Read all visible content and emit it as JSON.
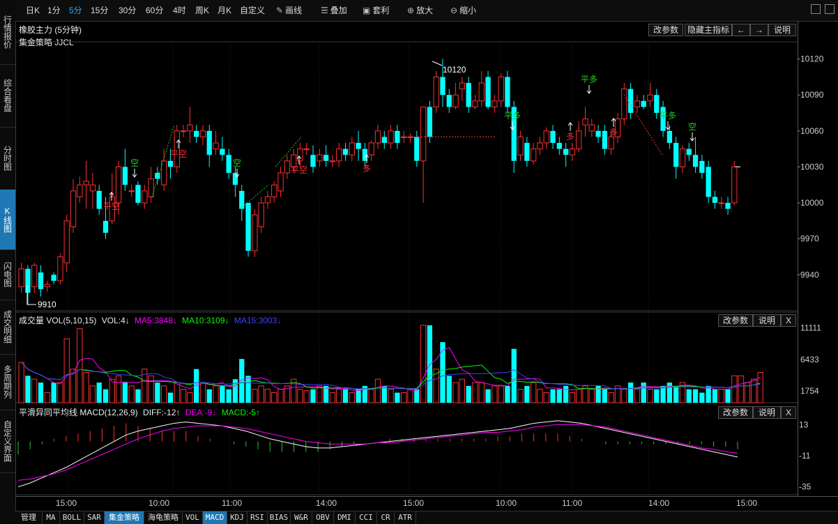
{
  "left_tabs": [
    {
      "label": "行情报价",
      "active": false
    },
    {
      "label": "综合看盘",
      "active": false
    },
    {
      "label": "分时图",
      "active": false
    },
    {
      "label": "K线图",
      "active": true
    },
    {
      "label": "闪电图",
      "active": false
    },
    {
      "label": "成交明细",
      "active": false
    },
    {
      "label": "多周期列",
      "active": false
    },
    {
      "label": "自定义界面",
      "active": false
    }
  ],
  "toolbar": {
    "periods": [
      "日K",
      "1分",
      "5分",
      "15分",
      "30分",
      "60分",
      "4时",
      "周K",
      "月K",
      "自定义"
    ],
    "active_period": "5分",
    "tools": [
      {
        "label": "画线",
        "icon": "pencil-icon"
      },
      {
        "label": "叠加",
        "icon": "stack-icon"
      },
      {
        "label": "套利",
        "icon": "arbitrage-icon"
      },
      {
        "label": "放大",
        "icon": "zoom-in-icon"
      },
      {
        "label": "缩小",
        "icon": "zoom-out-icon"
      }
    ]
  },
  "main_panel": {
    "title": "橡胶主力 (5分钟)",
    "strategy": "集金策略 JJCL",
    "buttons": [
      "改参数",
      "隐藏主指标",
      "←",
      "→",
      "说明"
    ],
    "y_labels": [
      "10120",
      "10090",
      "10060",
      "10030",
      "10000",
      "9970",
      "9940"
    ],
    "high_label": "10120",
    "low_label": "9910"
  },
  "vol_panel": {
    "title": "成交量 VOL(5,10,15)",
    "vol": "VOL:4↓",
    "ma5": "MA5:3848↓",
    "ma10": "MA10:3109↓",
    "ma15": "MA15:3003↓",
    "buttons": [
      "改参数",
      "说明",
      "X"
    ],
    "y_labels": [
      "11111",
      "6433",
      "1754"
    ]
  },
  "macd_panel": {
    "title": "平滑异同平均线 MACD(12,26,9)",
    "diff": "DIFF:-12↑",
    "dea": "DEA:-9↓",
    "macd": "MACD:-5↑",
    "buttons": [
      "改参数",
      "说明",
      "X"
    ],
    "y_labels": [
      "13",
      "-11",
      "-35"
    ]
  },
  "time_axis": [
    "15:00",
    "10:00",
    "11:00",
    "14:00",
    "15:00",
    "10:00",
    "11:00",
    "14:00",
    "15:00"
  ],
  "bottom_tabs": [
    "管理",
    "MA",
    "BOLL",
    "SAR",
    "集金策略",
    "海龟策略",
    "VOL",
    "MACD",
    "KDJ",
    "RSI",
    "BIAS",
    "W&R",
    "OBV",
    "DMI",
    "CCI",
    "CR",
    "ATR"
  ],
  "bottom_active": [
    "集金策略",
    "MACD"
  ],
  "colors": {
    "up": "#ff3030",
    "down": "#00ffff",
    "ma5": "#ff00ff",
    "ma10": "#00ff00",
    "ma15": "#4040ff",
    "diff": "#ffffff",
    "dea": "#ff00ff",
    "signal_green": "#22cc22",
    "signal_red": "#ff3030"
  },
  "signals": [
    {
      "text": "平空",
      "color": "red",
      "dir": "up"
    },
    {
      "text": "空",
      "color": "green",
      "dir": "down"
    },
    {
      "text": "平空",
      "color": "red",
      "dir": "up"
    },
    {
      "text": "空",
      "color": "green",
      "dir": "down"
    },
    {
      "text": "平空",
      "color": "red",
      "dir": "up"
    },
    {
      "text": "多",
      "color": "red",
      "dir": "up"
    },
    {
      "text": "平多",
      "color": "green",
      "dir": "down"
    },
    {
      "text": "多",
      "color": "red",
      "dir": "up"
    },
    {
      "text": "平多",
      "color": "green",
      "dir": "down"
    },
    {
      "text": "多",
      "color": "red",
      "dir": "up"
    },
    {
      "text": "平多",
      "color": "green",
      "dir": "down"
    },
    {
      "text": "空",
      "color": "green",
      "dir": "down"
    }
  ],
  "chart_data": {
    "type": "candlestick",
    "title": "橡胶主力 (5分钟)",
    "ylim": [
      9910,
      10125
    ],
    "candles": [
      [
        9930,
        9945,
        9925,
        9950
      ],
      [
        9945,
        9925,
        9915,
        9948
      ],
      [
        9930,
        9948,
        9925,
        9950
      ],
      [
        9942,
        9928,
        9922,
        9948
      ],
      [
        9930,
        9932,
        9926,
        9935
      ],
      [
        9940,
        9935,
        9932,
        9942
      ],
      [
        9935,
        9955,
        9932,
        9958
      ],
      [
        9950,
        9985,
        9942,
        9990
      ],
      [
        9980,
        10010,
        9975,
        10020
      ],
      [
        10005,
        10015,
        10000,
        10022
      ],
      [
        10015,
        10018,
        9995,
        10035
      ],
      [
        10010,
        10015,
        9995,
        10025
      ],
      [
        10010,
        9995,
        9990,
        10015
      ],
      [
        9985,
        9975,
        9970,
        10005
      ],
      [
        9985,
        10005,
        9982,
        10025
      ],
      [
        10000,
        10030,
        9990,
        10035
      ],
      [
        10030,
        10015,
        10010,
        10045
      ],
      [
        10010,
        10010,
        10005,
        10015
      ],
      [
        10015,
        10000,
        9998,
        10018
      ],
      [
        10000,
        10010,
        9995,
        10015
      ],
      [
        10005,
        10020,
        10000,
        10030
      ],
      [
        10025,
        10020,
        10015,
        10030
      ],
      [
        10015,
        10035,
        10010,
        10045
      ],
      [
        10035,
        10030,
        10020,
        10045
      ],
      [
        10030,
        10060,
        10025,
        10065
      ],
      [
        10060,
        10060,
        10055,
        10065
      ],
      [
        10060,
        10065,
        10050,
        10080
      ],
      [
        10060,
        10055,
        10050,
        10065
      ],
      [
        10055,
        10060,
        10048,
        10065
      ],
      [
        10060,
        10040,
        10030,
        10065
      ],
      [
        10045,
        10050,
        10040,
        10060
      ],
      [
        10045,
        10040,
        10035,
        10055
      ],
      [
        10040,
        10025,
        10020,
        10045
      ],
      [
        10025,
        10015,
        10005,
        10030
      ],
      [
        10010,
        9995,
        9985,
        10015
      ],
      [
        10000,
        9960,
        9955,
        10000
      ],
      [
        9960,
        9990,
        9955,
        9995
      ],
      [
        9980,
        10000,
        9975,
        10005
      ],
      [
        10000,
        10005,
        9995,
        10010
      ],
      [
        10005,
        10015,
        10000,
        10018
      ],
      [
        10010,
        10025,
        10005,
        10030
      ],
      [
        10025,
        10035,
        10020,
        10040
      ],
      [
        10030,
        10040,
        10025,
        10045
      ],
      [
        10035,
        10045,
        10030,
        10050
      ],
      [
        10045,
        10045,
        10040,
        10050
      ],
      [
        10040,
        10030,
        10025,
        10048
      ],
      [
        10035,
        10040,
        10030,
        10045
      ],
      [
        10040,
        10035,
        10030,
        10048
      ],
      [
        10035,
        10035,
        10030,
        10040
      ],
      [
        10035,
        10045,
        10030,
        10050
      ],
      [
        10045,
        10040,
        10035,
        10050
      ],
      [
        10040,
        10050,
        10035,
        10055
      ],
      [
        10050,
        10045,
        10035,
        10060
      ],
      [
        10045,
        10035,
        10030,
        10050
      ],
      [
        10040,
        10050,
        10035,
        10052
      ],
      [
        10050,
        10060,
        10045,
        10065
      ],
      [
        10055,
        10050,
        10045,
        10060
      ],
      [
        10050,
        10060,
        10045,
        10065
      ],
      [
        10060,
        10050,
        10045,
        10065
      ],
      [
        10055,
        10055,
        10050,
        10060
      ],
      [
        10055,
        10055,
        10050,
        10058
      ],
      [
        10055,
        10035,
        10030,
        10060
      ],
      [
        10035,
        10080,
        10000,
        10080
      ],
      [
        10080,
        10055,
        10050,
        10085
      ],
      [
        10080,
        10105,
        10075,
        10110
      ],
      [
        10105,
        10090,
        10080,
        10120
      ],
      [
        10090,
        10080,
        10075,
        10095
      ],
      [
        10080,
        10090,
        10078,
        10100
      ],
      [
        10095,
        10100,
        10085,
        10105
      ],
      [
        10100,
        10080,
        10075,
        10105
      ],
      [
        10080,
        10085,
        10078,
        10090
      ],
      [
        10085,
        10100,
        10080,
        10110
      ],
      [
        10105,
        10080,
        10078,
        10110
      ],
      [
        10080,
        10085,
        10075,
        10090
      ],
      [
        10085,
        10105,
        10080,
        10108
      ],
      [
        10105,
        10080,
        10075,
        10110
      ],
      [
        10080,
        10035,
        10025,
        10085
      ],
      [
        10040,
        10055,
        10035,
        10060
      ],
      [
        10050,
        10035,
        10030,
        10055
      ],
      [
        10035,
        10045,
        10032,
        10050
      ],
      [
        10045,
        10050,
        10040,
        10055
      ],
      [
        10050,
        10060,
        10045,
        10063
      ],
      [
        10060,
        10050,
        10045,
        10065
      ],
      [
        10050,
        10045,
        10040,
        10055
      ],
      [
        10045,
        10040,
        10030,
        10050
      ],
      [
        10040,
        10045,
        10035,
        10050
      ],
      [
        10045,
        10060,
        10042,
        10068
      ],
      [
        10065,
        10070,
        10055,
        10080
      ],
      [
        10060,
        10065,
        10055,
        10070
      ],
      [
        10060,
        10055,
        10050,
        10065
      ],
      [
        10060,
        10045,
        10040,
        10065
      ],
      [
        10045,
        10055,
        10040,
        10060
      ],
      [
        10055,
        10070,
        10050,
        10075
      ],
      [
        10070,
        10095,
        10065,
        10100
      ],
      [
        10095,
        10075,
        10070,
        10100
      ],
      [
        10080,
        10085,
        10075,
        10090
      ],
      [
        10085,
        10080,
        10078,
        10090
      ],
      [
        10085,
        10090,
        10080,
        10100
      ],
      [
        10090,
        10075,
        10070,
        10095
      ],
      [
        10080,
        10060,
        10055,
        10085
      ],
      [
        10060,
        10050,
        10045,
        10065
      ],
      [
        10050,
        10030,
        10020,
        10055
      ],
      [
        10030,
        10045,
        10025,
        10048
      ],
      [
        10045,
        10040,
        10035,
        10050
      ],
      [
        10040,
        10030,
        10025,
        10055
      ],
      [
        10035,
        10025,
        10020,
        10040
      ],
      [
        10030,
        10005,
        10000,
        10035
      ],
      [
        10005,
        10000,
        9995,
        10010
      ],
      [
        10000,
        10000,
        9995,
        10005
      ],
      [
        10000,
        9995,
        9990,
        10005
      ],
      [
        10000,
        10030,
        9998,
        10035
      ]
    ],
    "volume": [
      6000,
      4000,
      3500,
      3000,
      1500,
      3000,
      3000,
      9500,
      5000,
      11000,
      4500,
      2500,
      3000,
      2000,
      3500,
      4000,
      3000,
      2500,
      2000,
      5000,
      4000,
      3000,
      2500,
      1500,
      3000,
      2000,
      1500,
      5000,
      3000,
      2000,
      2500,
      2500,
      2000,
      3500,
      6500,
      4000,
      2000,
      2500,
      2000,
      1500,
      2000,
      2500,
      3500,
      2000,
      1800,
      2000,
      2500,
      2500,
      1500,
      2000,
      2000,
      1500,
      2000,
      2500,
      2000,
      3500,
      2500,
      2000,
      1500,
      1500,
      2000,
      2000,
      11500,
      11500,
      5000,
      9000,
      4000,
      3000,
      3500,
      2500,
      3000,
      3000,
      2000,
      2500,
      2500,
      2500,
      8000,
      2000,
      2500,
      3000,
      2000,
      1500,
      2000,
      2000,
      2500,
      1500,
      2000,
      2500,
      2000,
      2500,
      2000,
      1500,
      2500,
      2000,
      3000,
      2000,
      3000,
      2000,
      2000,
      2500,
      3000,
      2500,
      3000,
      2000,
      2000,
      1500,
      2500,
      2000,
      2000,
      2000,
      4000,
      4000,
      3000,
      3500,
      4500
    ],
    "macd": {
      "diff": [
        -35,
        -32,
        -28,
        -24,
        -20,
        -15,
        -10,
        -5,
        0,
        5,
        8,
        10,
        12,
        14,
        15,
        14,
        13,
        12,
        10,
        8,
        5,
        2,
        0,
        -2,
        -4,
        -5,
        -5,
        -4,
        -3,
        -2,
        -1,
        0,
        1,
        2,
        3,
        4,
        5,
        6,
        7,
        8,
        9,
        10,
        12,
        14,
        15,
        16,
        15,
        14,
        12,
        10,
        8,
        6,
        4,
        2,
        0,
        -2,
        -4,
        -6,
        -8,
        -10,
        -12
      ],
      "dea": [
        -30,
        -29,
        -27,
        -25,
        -22,
        -18,
        -14,
        -10,
        -6,
        -2,
        2,
        5,
        8,
        10,
        11,
        12,
        12,
        12,
        11,
        10,
        8,
        6,
        4,
        2,
        0,
        -1,
        -2,
        -2,
        -2,
        -2,
        -1,
        -1,
        0,
        1,
        2,
        3,
        4,
        5,
        6,
        7,
        7,
        8,
        9,
        11,
        12,
        13,
        13,
        13,
        12,
        11,
        9,
        7,
        5,
        3,
        1,
        -1,
        -3,
        -5,
        -6,
        -8,
        -9
      ]
    }
  }
}
